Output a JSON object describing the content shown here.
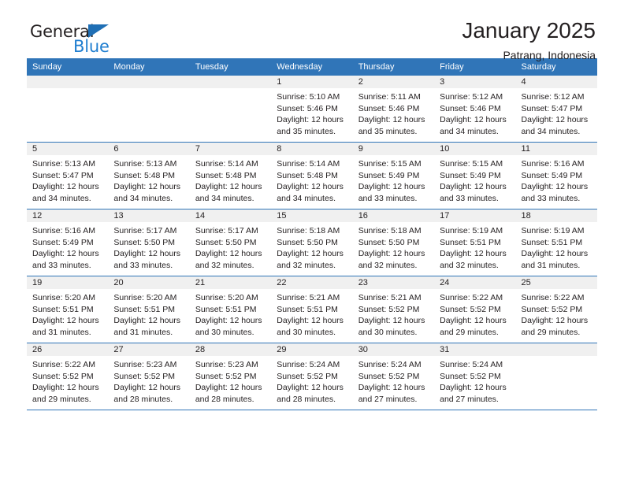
{
  "brand": {
    "name_top": "General",
    "name_bottom": "Blue",
    "accent_color": "#1f7ed0",
    "triangle_color": "#1f6fb5"
  },
  "header": {
    "title": "January 2025",
    "subtitle": "Patrang, Indonesia"
  },
  "theme": {
    "header_row_bg": "#3075b8",
    "daynum_band_bg": "#f0f0f0",
    "grid_line": "#3075b8",
    "text": "#231f20"
  },
  "calendar": {
    "weekday_headers": [
      "Sunday",
      "Monday",
      "Tuesday",
      "Wednesday",
      "Thursday",
      "Friday",
      "Saturday"
    ],
    "weeks": [
      [
        {
          "day": ""
        },
        {
          "day": ""
        },
        {
          "day": ""
        },
        {
          "day": "1",
          "sunrise": "Sunrise: 5:10 AM",
          "sunset": "Sunset: 5:46 PM",
          "daylight_1": "Daylight: 12 hours",
          "daylight_2": "and 35 minutes."
        },
        {
          "day": "2",
          "sunrise": "Sunrise: 5:11 AM",
          "sunset": "Sunset: 5:46 PM",
          "daylight_1": "Daylight: 12 hours",
          "daylight_2": "and 35 minutes."
        },
        {
          "day": "3",
          "sunrise": "Sunrise: 5:12 AM",
          "sunset": "Sunset: 5:46 PM",
          "daylight_1": "Daylight: 12 hours",
          "daylight_2": "and 34 minutes."
        },
        {
          "day": "4",
          "sunrise": "Sunrise: 5:12 AM",
          "sunset": "Sunset: 5:47 PM",
          "daylight_1": "Daylight: 12 hours",
          "daylight_2": "and 34 minutes."
        }
      ],
      [
        {
          "day": "5",
          "sunrise": "Sunrise: 5:13 AM",
          "sunset": "Sunset: 5:47 PM",
          "daylight_1": "Daylight: 12 hours",
          "daylight_2": "and 34 minutes."
        },
        {
          "day": "6",
          "sunrise": "Sunrise: 5:13 AM",
          "sunset": "Sunset: 5:48 PM",
          "daylight_1": "Daylight: 12 hours",
          "daylight_2": "and 34 minutes."
        },
        {
          "day": "7",
          "sunrise": "Sunrise: 5:14 AM",
          "sunset": "Sunset: 5:48 PM",
          "daylight_1": "Daylight: 12 hours",
          "daylight_2": "and 34 minutes."
        },
        {
          "day": "8",
          "sunrise": "Sunrise: 5:14 AM",
          "sunset": "Sunset: 5:48 PM",
          "daylight_1": "Daylight: 12 hours",
          "daylight_2": "and 34 minutes."
        },
        {
          "day": "9",
          "sunrise": "Sunrise: 5:15 AM",
          "sunset": "Sunset: 5:49 PM",
          "daylight_1": "Daylight: 12 hours",
          "daylight_2": "and 33 minutes."
        },
        {
          "day": "10",
          "sunrise": "Sunrise: 5:15 AM",
          "sunset": "Sunset: 5:49 PM",
          "daylight_1": "Daylight: 12 hours",
          "daylight_2": "and 33 minutes."
        },
        {
          "day": "11",
          "sunrise": "Sunrise: 5:16 AM",
          "sunset": "Sunset: 5:49 PM",
          "daylight_1": "Daylight: 12 hours",
          "daylight_2": "and 33 minutes."
        }
      ],
      [
        {
          "day": "12",
          "sunrise": "Sunrise: 5:16 AM",
          "sunset": "Sunset: 5:49 PM",
          "daylight_1": "Daylight: 12 hours",
          "daylight_2": "and 33 minutes."
        },
        {
          "day": "13",
          "sunrise": "Sunrise: 5:17 AM",
          "sunset": "Sunset: 5:50 PM",
          "daylight_1": "Daylight: 12 hours",
          "daylight_2": "and 33 minutes."
        },
        {
          "day": "14",
          "sunrise": "Sunrise: 5:17 AM",
          "sunset": "Sunset: 5:50 PM",
          "daylight_1": "Daylight: 12 hours",
          "daylight_2": "and 32 minutes."
        },
        {
          "day": "15",
          "sunrise": "Sunrise: 5:18 AM",
          "sunset": "Sunset: 5:50 PM",
          "daylight_1": "Daylight: 12 hours",
          "daylight_2": "and 32 minutes."
        },
        {
          "day": "16",
          "sunrise": "Sunrise: 5:18 AM",
          "sunset": "Sunset: 5:50 PM",
          "daylight_1": "Daylight: 12 hours",
          "daylight_2": "and 32 minutes."
        },
        {
          "day": "17",
          "sunrise": "Sunrise: 5:19 AM",
          "sunset": "Sunset: 5:51 PM",
          "daylight_1": "Daylight: 12 hours",
          "daylight_2": "and 32 minutes."
        },
        {
          "day": "18",
          "sunrise": "Sunrise: 5:19 AM",
          "sunset": "Sunset: 5:51 PM",
          "daylight_1": "Daylight: 12 hours",
          "daylight_2": "and 31 minutes."
        }
      ],
      [
        {
          "day": "19",
          "sunrise": "Sunrise: 5:20 AM",
          "sunset": "Sunset: 5:51 PM",
          "daylight_1": "Daylight: 12 hours",
          "daylight_2": "and 31 minutes."
        },
        {
          "day": "20",
          "sunrise": "Sunrise: 5:20 AM",
          "sunset": "Sunset: 5:51 PM",
          "daylight_1": "Daylight: 12 hours",
          "daylight_2": "and 31 minutes."
        },
        {
          "day": "21",
          "sunrise": "Sunrise: 5:20 AM",
          "sunset": "Sunset: 5:51 PM",
          "daylight_1": "Daylight: 12 hours",
          "daylight_2": "and 30 minutes."
        },
        {
          "day": "22",
          "sunrise": "Sunrise: 5:21 AM",
          "sunset": "Sunset: 5:51 PM",
          "daylight_1": "Daylight: 12 hours",
          "daylight_2": "and 30 minutes."
        },
        {
          "day": "23",
          "sunrise": "Sunrise: 5:21 AM",
          "sunset": "Sunset: 5:52 PM",
          "daylight_1": "Daylight: 12 hours",
          "daylight_2": "and 30 minutes."
        },
        {
          "day": "24",
          "sunrise": "Sunrise: 5:22 AM",
          "sunset": "Sunset: 5:52 PM",
          "daylight_1": "Daylight: 12 hours",
          "daylight_2": "and 29 minutes."
        },
        {
          "day": "25",
          "sunrise": "Sunrise: 5:22 AM",
          "sunset": "Sunset: 5:52 PM",
          "daylight_1": "Daylight: 12 hours",
          "daylight_2": "and 29 minutes."
        }
      ],
      [
        {
          "day": "26",
          "sunrise": "Sunrise: 5:22 AM",
          "sunset": "Sunset: 5:52 PM",
          "daylight_1": "Daylight: 12 hours",
          "daylight_2": "and 29 minutes."
        },
        {
          "day": "27",
          "sunrise": "Sunrise: 5:23 AM",
          "sunset": "Sunset: 5:52 PM",
          "daylight_1": "Daylight: 12 hours",
          "daylight_2": "and 28 minutes."
        },
        {
          "day": "28",
          "sunrise": "Sunrise: 5:23 AM",
          "sunset": "Sunset: 5:52 PM",
          "daylight_1": "Daylight: 12 hours",
          "daylight_2": "and 28 minutes."
        },
        {
          "day": "29",
          "sunrise": "Sunrise: 5:24 AM",
          "sunset": "Sunset: 5:52 PM",
          "daylight_1": "Daylight: 12 hours",
          "daylight_2": "and 28 minutes."
        },
        {
          "day": "30",
          "sunrise": "Sunrise: 5:24 AM",
          "sunset": "Sunset: 5:52 PM",
          "daylight_1": "Daylight: 12 hours",
          "daylight_2": "and 27 minutes."
        },
        {
          "day": "31",
          "sunrise": "Sunrise: 5:24 AM",
          "sunset": "Sunset: 5:52 PM",
          "daylight_1": "Daylight: 12 hours",
          "daylight_2": "and 27 minutes."
        },
        {
          "day": ""
        }
      ]
    ]
  }
}
